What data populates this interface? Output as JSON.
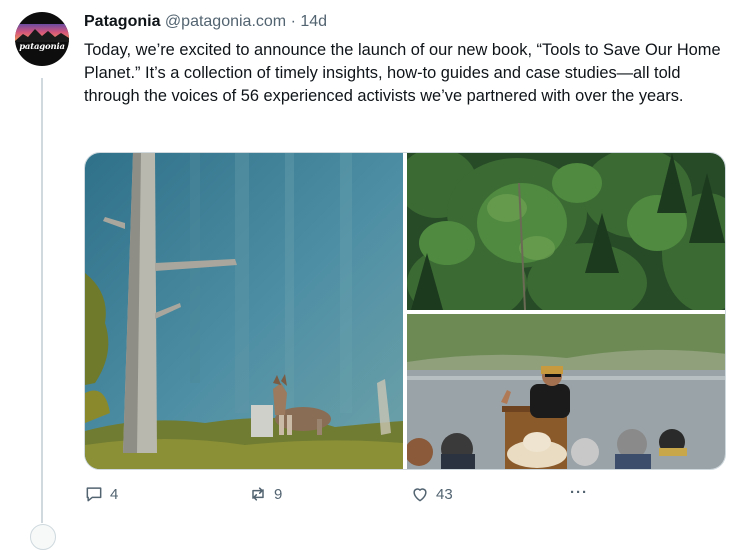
{
  "tweet": {
    "author_name": "Patagonia",
    "handle": "@patagonia.com",
    "separator": "·",
    "time": "14d",
    "avatar_logo_text": "patagonia",
    "text": "Today, we’re excited to announce the launch of our new book, “Tools to Save Our Home Planet.” It’s a collection of timely insights, how-to guides and case studies—all told through the voices of 56 experienced activists we’ve partnered with over the years.",
    "media": [
      {
        "name": "wolf-forest-photo",
        "icon": "photo"
      },
      {
        "name": "forest-canopy-photo",
        "icon": "photo"
      },
      {
        "name": "speaker-podium-photo",
        "icon": "photo"
      }
    ],
    "actions": {
      "reply_count": "4",
      "retweet_count": "9",
      "like_count": "43",
      "more_label": "···"
    },
    "icons": {
      "reply": "reply-icon",
      "retweet": "retweet-icon",
      "like": "heart-icon",
      "more": "more-icon"
    },
    "colors": {
      "text": "#0f1419",
      "secondary": "#536471",
      "border": "#cfd9de"
    }
  }
}
